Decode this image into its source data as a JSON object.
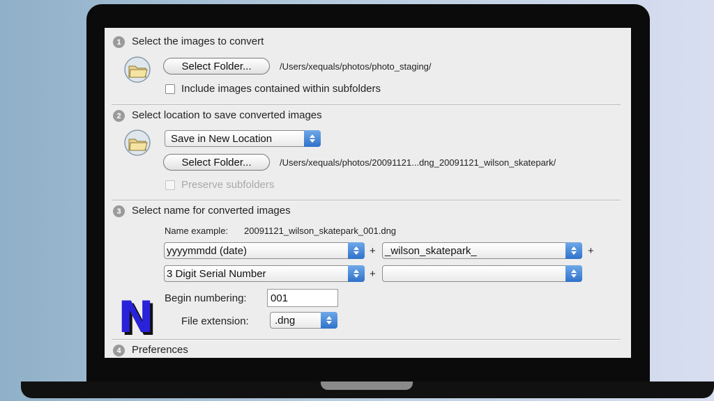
{
  "sections": {
    "s1": {
      "num": "1",
      "title": "Select the images to convert"
    },
    "s2": {
      "num": "2",
      "title": "Select location to save converted images"
    },
    "s3": {
      "num": "3",
      "title": "Select name for converted images"
    },
    "s4": {
      "num": "4",
      "title": "Preferences"
    }
  },
  "source": {
    "button_label": "Select Folder...",
    "path": "/Users/xequals/photos/photo_staging/",
    "subfolders_label": "Include images contained within subfolders"
  },
  "destination": {
    "location_value": "Save in New Location",
    "button_label": "Select Folder...",
    "path": "/Users/xequals/photos/20091121...dng_20091121_wilson_skatepark/",
    "preserve_label": "Preserve subfolders"
  },
  "naming": {
    "example_label": "Name example:",
    "example_value": "20091121_wilson_skatepark_001.dng",
    "field1": "yyyymmdd (date)",
    "field2": "_wilson_skatepark_",
    "field3": "3 Digit Serial Number",
    "field4": "",
    "plus": "+",
    "begin_label": "Begin numbering:",
    "begin_value": "001",
    "ext_label": "File extension:",
    "ext_value": ".dng"
  },
  "colors": {
    "accent": "#2f72c9",
    "logo": "#2a22d8"
  },
  "logo": {
    "letter": "N"
  }
}
